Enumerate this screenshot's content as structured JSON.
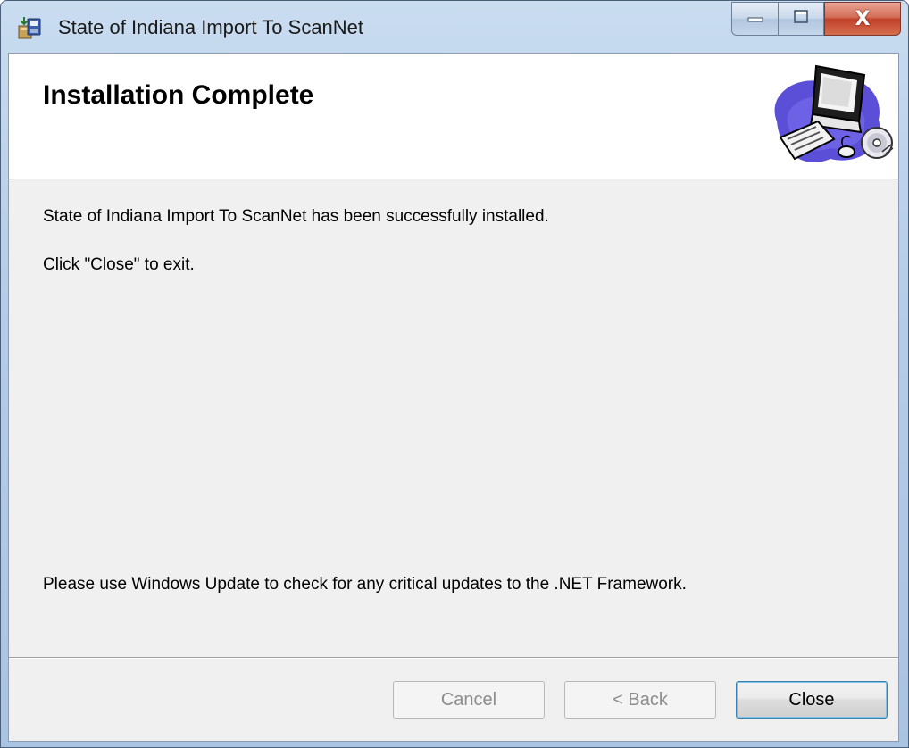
{
  "window": {
    "title": "State of Indiana Import To ScanNet",
    "icon": "installer-package-icon"
  },
  "caption_buttons": {
    "minimize_icon": "minimize-icon",
    "maximize_icon": "maximize-icon",
    "close_label": "X"
  },
  "header": {
    "title": "Installation Complete",
    "graphic": "computer-with-cd-clipart"
  },
  "body": {
    "success_message": "State of Indiana Import To ScanNet has been successfully installed.",
    "exit_instruction": "Click \"Close\" to exit.",
    "update_notice": "Please use Windows Update to check for any critical updates to the .NET Framework."
  },
  "buttons": {
    "cancel_label": "Cancel",
    "back_label": "< Back",
    "close_label": "Close",
    "cancel_enabled": false,
    "back_enabled": false,
    "close_enabled": true
  },
  "colors": {
    "titlebar": "#b5cde8",
    "client_bg": "#f0f0f0",
    "header_bg": "#ffffff",
    "close_button_red": "#c2402a",
    "default_button_border": "#3c7fb1"
  }
}
